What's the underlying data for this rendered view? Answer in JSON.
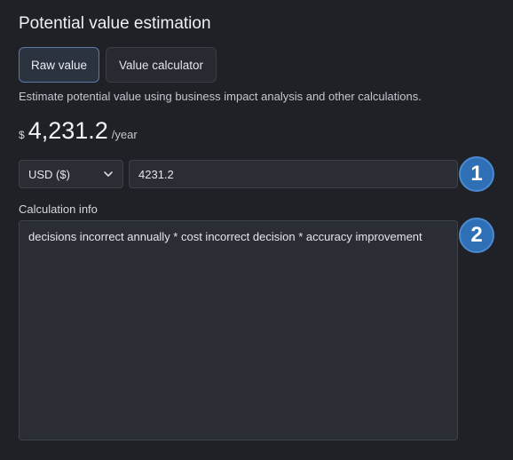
{
  "header": {
    "title": "Potential value estimation"
  },
  "tabs": [
    {
      "label": "Raw value",
      "active": true
    },
    {
      "label": "Value calculator",
      "active": false
    }
  ],
  "description": "Estimate potential value using business impact analysis and other calculations.",
  "summary": {
    "currency_symbol": "$",
    "amount": "4,231.2",
    "period": "/year"
  },
  "form": {
    "currency_select": {
      "selected": "USD ($)",
      "icon": "chevron-down-icon"
    },
    "amount_input": {
      "value": "4231.2"
    },
    "calc_label": "Calculation info",
    "calc_textarea": {
      "value": "decisions incorrect annually * cost incorrect decision * accuracy improvement"
    }
  },
  "callouts": [
    {
      "number": "1"
    },
    {
      "number": "2"
    }
  ],
  "colors": {
    "background": "#1f2126",
    "active_tab_border": "#5d7aa6",
    "callout_fill": "#2f6fb5"
  }
}
